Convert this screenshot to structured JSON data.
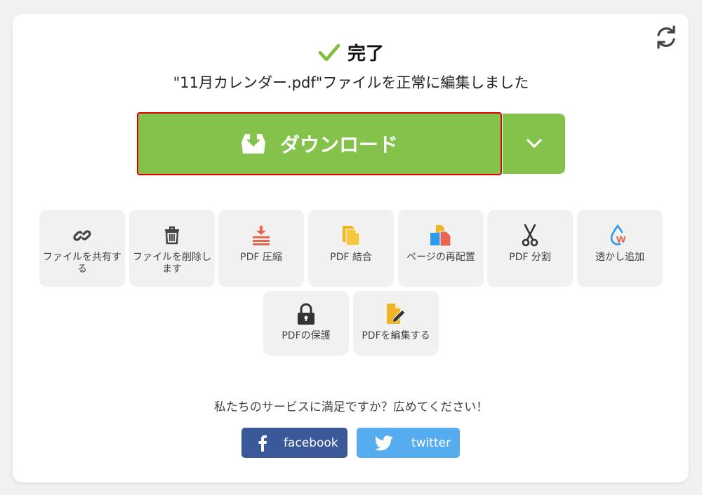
{
  "header": {
    "status_title": "完了",
    "subtitle": "\"11月カレンダー.pdf\"ファイルを正常に編集しました",
    "icons": {
      "check": "check-icon",
      "refresh": "refresh-icon"
    }
  },
  "download": {
    "label": "ダウンロード",
    "icon": "download-tray-icon",
    "dropdown_icon": "chevron-down-icon"
  },
  "tools": [
    {
      "label": "ファイルを共有する",
      "icon": "link-icon"
    },
    {
      "label": "ファイルを削除します",
      "icon": "trash-icon"
    },
    {
      "label": "PDF 圧縮",
      "icon": "compress-icon"
    },
    {
      "label": "PDF 結合",
      "icon": "merge-icon"
    },
    {
      "label": "ページの再配置",
      "icon": "rearrange-pages-icon"
    },
    {
      "label": "PDF 分割",
      "icon": "scissors-icon"
    },
    {
      "label": "透かし追加",
      "icon": "watermark-icon"
    },
    {
      "label": "PDFの保護",
      "icon": "lock-icon"
    },
    {
      "label": "PDFを編集する",
      "icon": "edit-pdf-icon"
    }
  ],
  "share": {
    "question": "私たちのサービスに満足ですか？広めてください！",
    "facebook_label": "facebook",
    "twitter_label": "twitter"
  },
  "colors": {
    "accent_green": "#85c24b",
    "facebook": "#3b5998",
    "twitter": "#55acee",
    "highlight_border": "#e00000",
    "icon_orange": "#f0b429",
    "icon_red": "#e8654f",
    "icon_blue": "#2d9cf0"
  }
}
